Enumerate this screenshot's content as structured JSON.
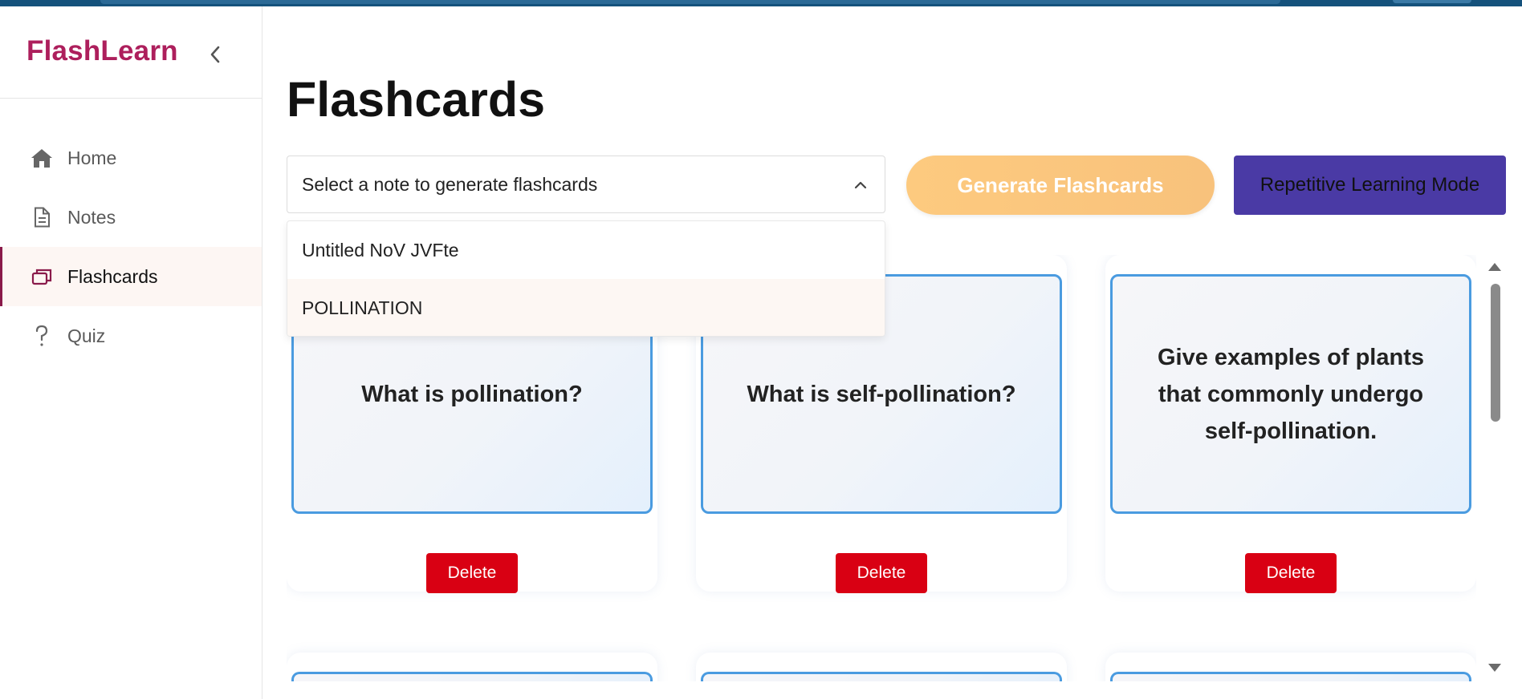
{
  "app": {
    "brand": "FlashLearn"
  },
  "sidebar": {
    "items": [
      {
        "label": "Home",
        "icon": "home-icon"
      },
      {
        "label": "Notes",
        "icon": "document-icon"
      },
      {
        "label": "Flashcards",
        "icon": "cards-icon",
        "active": true
      },
      {
        "label": "Quiz",
        "icon": "question-icon"
      }
    ]
  },
  "main": {
    "title": "Flashcards",
    "select": {
      "placeholder": "Select a note to generate flashcards",
      "expanded": true,
      "options": [
        "Untitled NoV JVFte",
        "POLLINATION"
      ],
      "highlighted_option": "POLLINATION"
    },
    "generate_label": "Generate Flashcards",
    "repetitive_label": "Repetitive Learning Mode",
    "cards": [
      {
        "question": "What is pollination?",
        "delete_label": "Delete"
      },
      {
        "question": "What is self-pollination?",
        "delete_label": "Delete"
      },
      {
        "question": "Give examples of plants that commonly undergo self-pollination.",
        "delete_label": "Delete"
      }
    ]
  },
  "colors": {
    "brand": "#ad1f5c",
    "card_border": "#4a9be0",
    "delete": "#d90013",
    "generate": "#fdca7f",
    "repetitive": "#4a3aa5"
  }
}
